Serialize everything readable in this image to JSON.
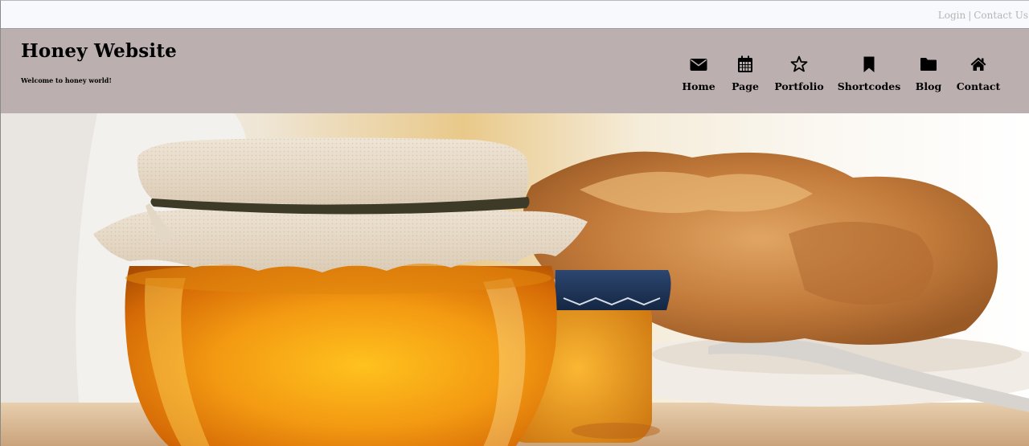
{
  "topbar": {
    "login": "Login",
    "separator": "|",
    "contact": "Contact Us"
  },
  "header": {
    "title": "Honey Website",
    "tagline": "Welcome to honey world!"
  },
  "nav": [
    {
      "label": "Home",
      "icon": "envelope-icon"
    },
    {
      "label": "Page",
      "icon": "calendar-icon"
    },
    {
      "label": "Portfolio",
      "icon": "star-icon"
    },
    {
      "label": "Shortcodes",
      "icon": "bookmark-icon"
    },
    {
      "label": "Blog",
      "icon": "folder-icon"
    },
    {
      "label": "Contact",
      "icon": "home-icon"
    }
  ],
  "colors": {
    "topbar_bg": "#f8f9fd",
    "header_bg": "#bbafaf",
    "link_gray": "#b5b5b5"
  },
  "hero": {
    "image": "honey-jar-photo"
  }
}
